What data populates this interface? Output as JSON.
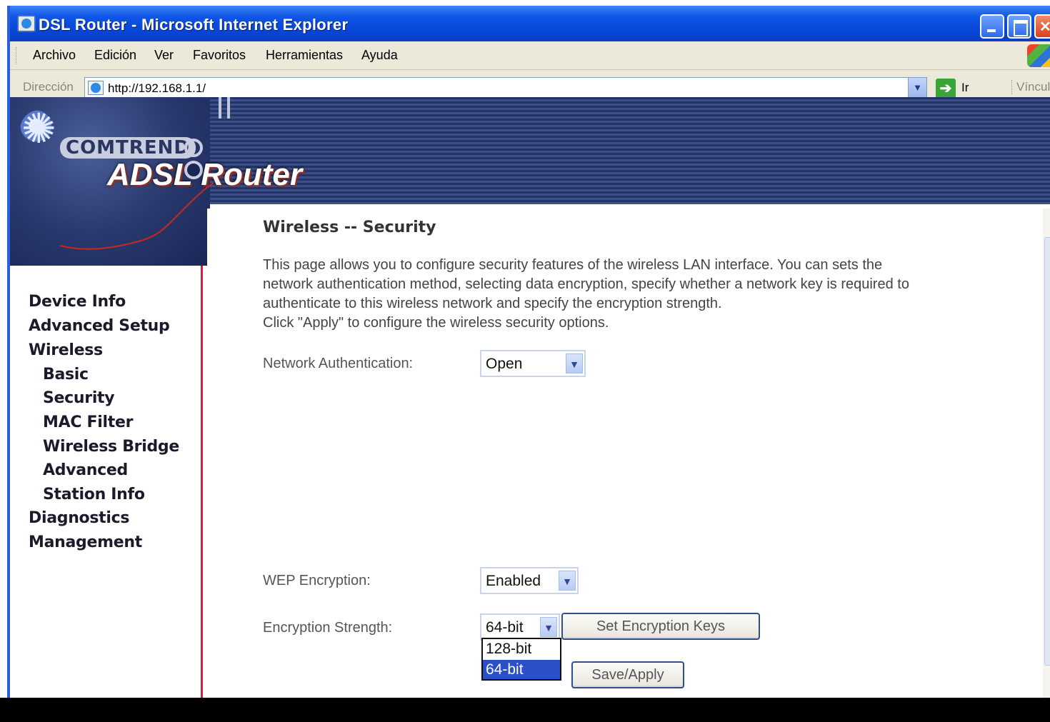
{
  "window": {
    "title": "DSL Router - Microsoft Internet Explorer"
  },
  "menubar": {
    "items": [
      "Archivo",
      "Edición",
      "Ver",
      "Favoritos",
      "Herramientas",
      "Ayuda"
    ]
  },
  "addressbar": {
    "label": "Dirección",
    "url": "http://192.168.1.1/",
    "go_label": "Ir",
    "links_label": "Vínculo"
  },
  "banner": {
    "brand": "COMTREND",
    "product": "ADSL Router"
  },
  "sidebar": {
    "items": [
      {
        "label": "Device Info"
      },
      {
        "label": "Advanced Setup"
      },
      {
        "label": "Wireless"
      },
      {
        "label": "Basic"
      },
      {
        "label": "Security"
      },
      {
        "label": "MAC Filter"
      },
      {
        "label": "Wireless Bridge"
      },
      {
        "label": "Advanced"
      },
      {
        "label": "Station Info"
      },
      {
        "label": "Diagnostics"
      },
      {
        "label": "Management"
      }
    ]
  },
  "main": {
    "title": "Wireless -- Security",
    "intro_lines": [
      "This page allows you to configure security features of the wireless LAN interface. You can sets the",
      "network authentication method, selecting data encryption, specify whether a network key is required to",
      "authenticate to this wireless network and specify the encryption strength.",
      "Click \"Apply\" to configure the wireless security options."
    ],
    "network_auth": {
      "label": "Network Authentication:",
      "value": "Open"
    },
    "wep_encryption": {
      "label": "WEP Encryption:",
      "value": "Enabled"
    },
    "encryption_strength": {
      "label": "Encryption Strength:",
      "value": "64-bit",
      "options": [
        "128-bit",
        "64-bit"
      ],
      "highlighted_option": "64-bit"
    },
    "set_keys_button": "Set Encryption Keys",
    "save_button": "Save/Apply"
  },
  "colors": {
    "titlebar": "#0846d6",
    "sidebar_border": "#d2203a",
    "selected_option": "#2a4fc6"
  }
}
